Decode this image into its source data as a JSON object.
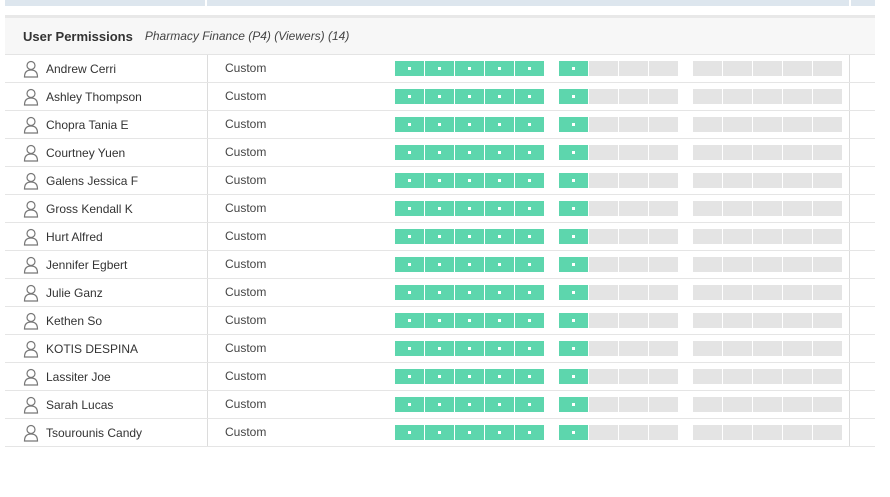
{
  "header": {
    "title": "User Permissions",
    "subtitle": "Pharmacy Finance (P4) (Viewers) (14)"
  },
  "colors": {
    "granted": "#5dd6ad",
    "denied": "#e4e4e4"
  },
  "permission_groups": [
    {
      "name": "group-1",
      "cells": [
        1,
        1,
        1,
        1,
        1
      ]
    },
    {
      "name": "group-2",
      "cells": [
        1,
        0,
        0,
        0
      ]
    },
    {
      "name": "group-3",
      "cells": [
        0,
        0,
        0,
        0,
        0
      ]
    }
  ],
  "users": [
    {
      "name": "Andrew Cerri",
      "role": "Custom",
      "icon": "user-icon"
    },
    {
      "name": "Ashley Thompson",
      "role": "Custom",
      "icon": "user-icon"
    },
    {
      "name": "Chopra Tania E",
      "role": "Custom",
      "icon": "user-icon"
    },
    {
      "name": "Courtney Yuen",
      "role": "Custom",
      "icon": "user-icon"
    },
    {
      "name": "Galens Jessica F",
      "role": "Custom",
      "icon": "user-icon"
    },
    {
      "name": "Gross Kendall K",
      "role": "Custom",
      "icon": "user-icon"
    },
    {
      "name": "Hurt Alfred",
      "role": "Custom",
      "icon": "user-icon"
    },
    {
      "name": "Jennifer Egbert",
      "role": "Custom",
      "icon": "user-icon"
    },
    {
      "name": "Julie Ganz",
      "role": "Custom",
      "icon": "user-icon"
    },
    {
      "name": "Kethen So",
      "role": "Custom",
      "icon": "user-icon"
    },
    {
      "name": "KOTIS DESPINA",
      "role": "Custom",
      "icon": "user-icon"
    },
    {
      "name": "Lassiter Joe",
      "role": "Custom",
      "icon": "user-icon"
    },
    {
      "name": "Sarah Lucas",
      "role": "Custom",
      "icon": "user-icon"
    },
    {
      "name": "Tsourounis Candy",
      "role": "Custom",
      "icon": "user-icon"
    }
  ]
}
